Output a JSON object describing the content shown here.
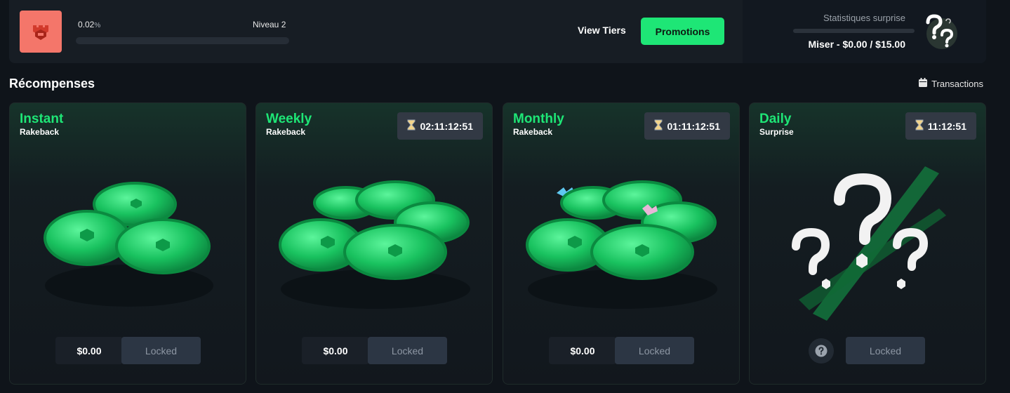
{
  "header": {
    "progress_percent": "0.02",
    "progress_symbol": "%",
    "progress_fraction": 0.0002,
    "level_label": "Niveau 2",
    "view_tiers_label": "View Tiers",
    "promotions_label": "Promotions"
  },
  "stats": {
    "label": "Statistiques surprise",
    "miser": "Miser - $0.00 / $15.00",
    "progress_fraction": 0.0
  },
  "section": {
    "title": "Récompenses",
    "transactions_label": "Transactions"
  },
  "cards": [
    {
      "title": "Instant",
      "subtitle": "Rakeback",
      "timer": "",
      "amount": "$0.00",
      "button": "Locked"
    },
    {
      "title": "Weekly",
      "subtitle": "Rakeback",
      "timer": "02:11:12:51",
      "amount": "$0.00",
      "button": "Locked"
    },
    {
      "title": "Monthly",
      "subtitle": "Rakeback",
      "timer": "01:11:12:51",
      "amount": "$0.00",
      "button": "Locked"
    },
    {
      "title": "Daily",
      "subtitle": "Surprise",
      "timer": "11:12:51",
      "amount": "",
      "button": "Locked"
    }
  ],
  "colors": {
    "accent": "#1ee676",
    "level_badge": "#f4766a",
    "background": "#0f141a",
    "locked_button": "#2c3644"
  },
  "icons": {
    "level": "castle-icon",
    "stats": "question-marks-icon",
    "transactions": "calendar-icon",
    "timer": "hourglass-icon",
    "help": "question-circle-icon"
  }
}
